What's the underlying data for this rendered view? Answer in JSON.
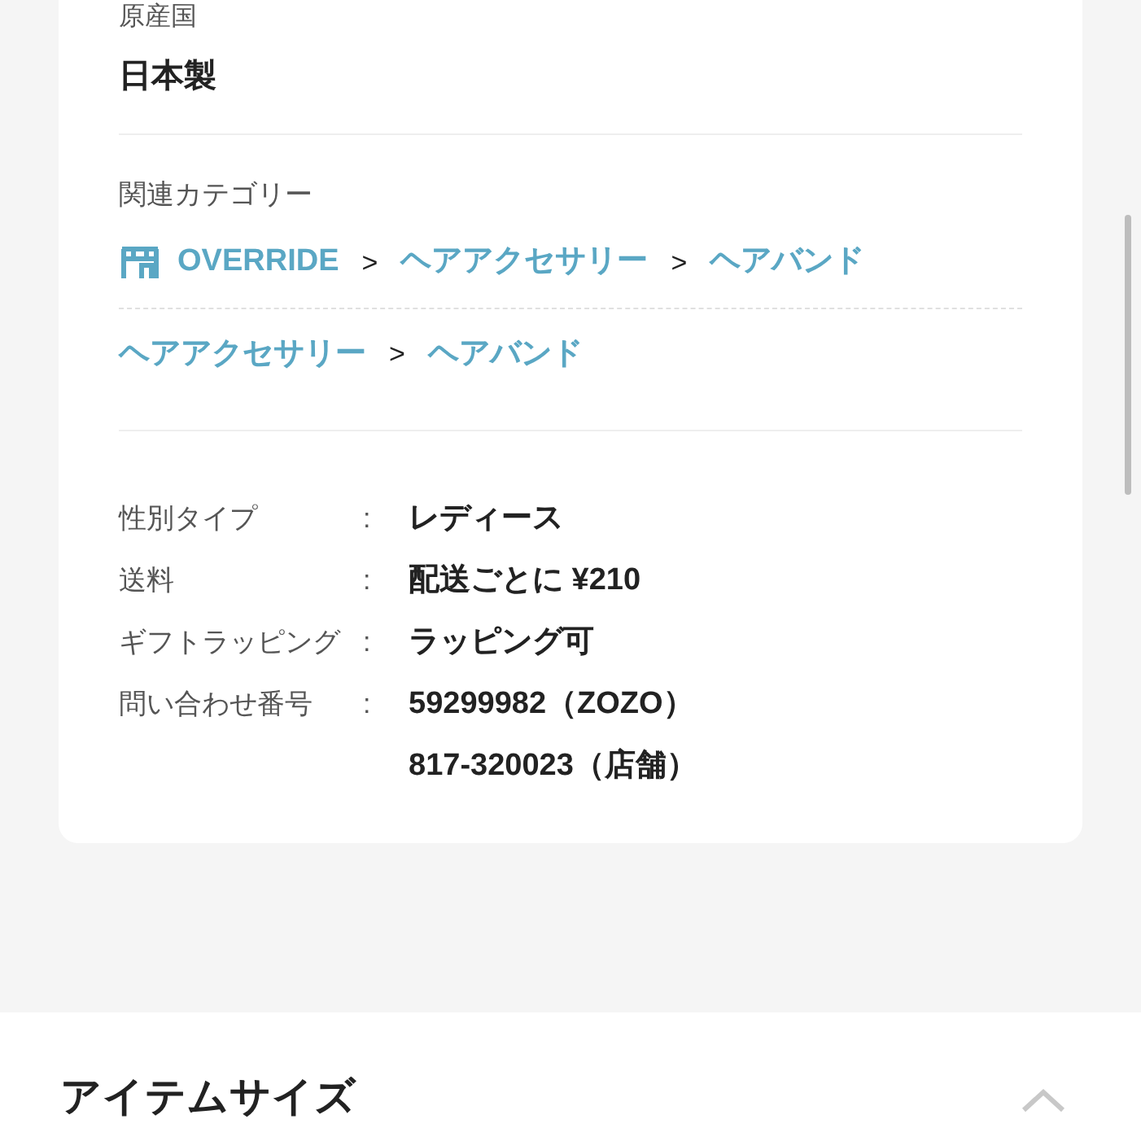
{
  "origin": {
    "label": "原産国",
    "value": "日本製"
  },
  "related_categories": {
    "label": "関連カテゴリー",
    "separator": ">",
    "paths": [
      {
        "items": [
          {
            "kind": "shop",
            "text": "OVERRIDE"
          },
          {
            "kind": "category",
            "text": "ヘアアクセサリー"
          },
          {
            "kind": "category",
            "text": "ヘアバンド"
          }
        ]
      },
      {
        "items": [
          {
            "kind": "category",
            "text": "ヘアアクセサリー"
          },
          {
            "kind": "category",
            "text": "ヘアバンド"
          }
        ]
      }
    ]
  },
  "details": [
    {
      "label": "性別タイプ",
      "colon": ":",
      "values": [
        "レディース"
      ]
    },
    {
      "label": "送料",
      "colon": ":",
      "values": [
        "配送ごとに ¥210"
      ]
    },
    {
      "label": "ギフトラッピング",
      "colon": ":",
      "values": [
        "ラッピング可"
      ]
    },
    {
      "label": "問い合わせ番号",
      "colon": ":",
      "values": [
        "59299982（ZOZO）",
        "817-320023（店舗）"
      ]
    }
  ],
  "item_size_section": {
    "title": "アイテムサイズ",
    "expanded": true
  }
}
